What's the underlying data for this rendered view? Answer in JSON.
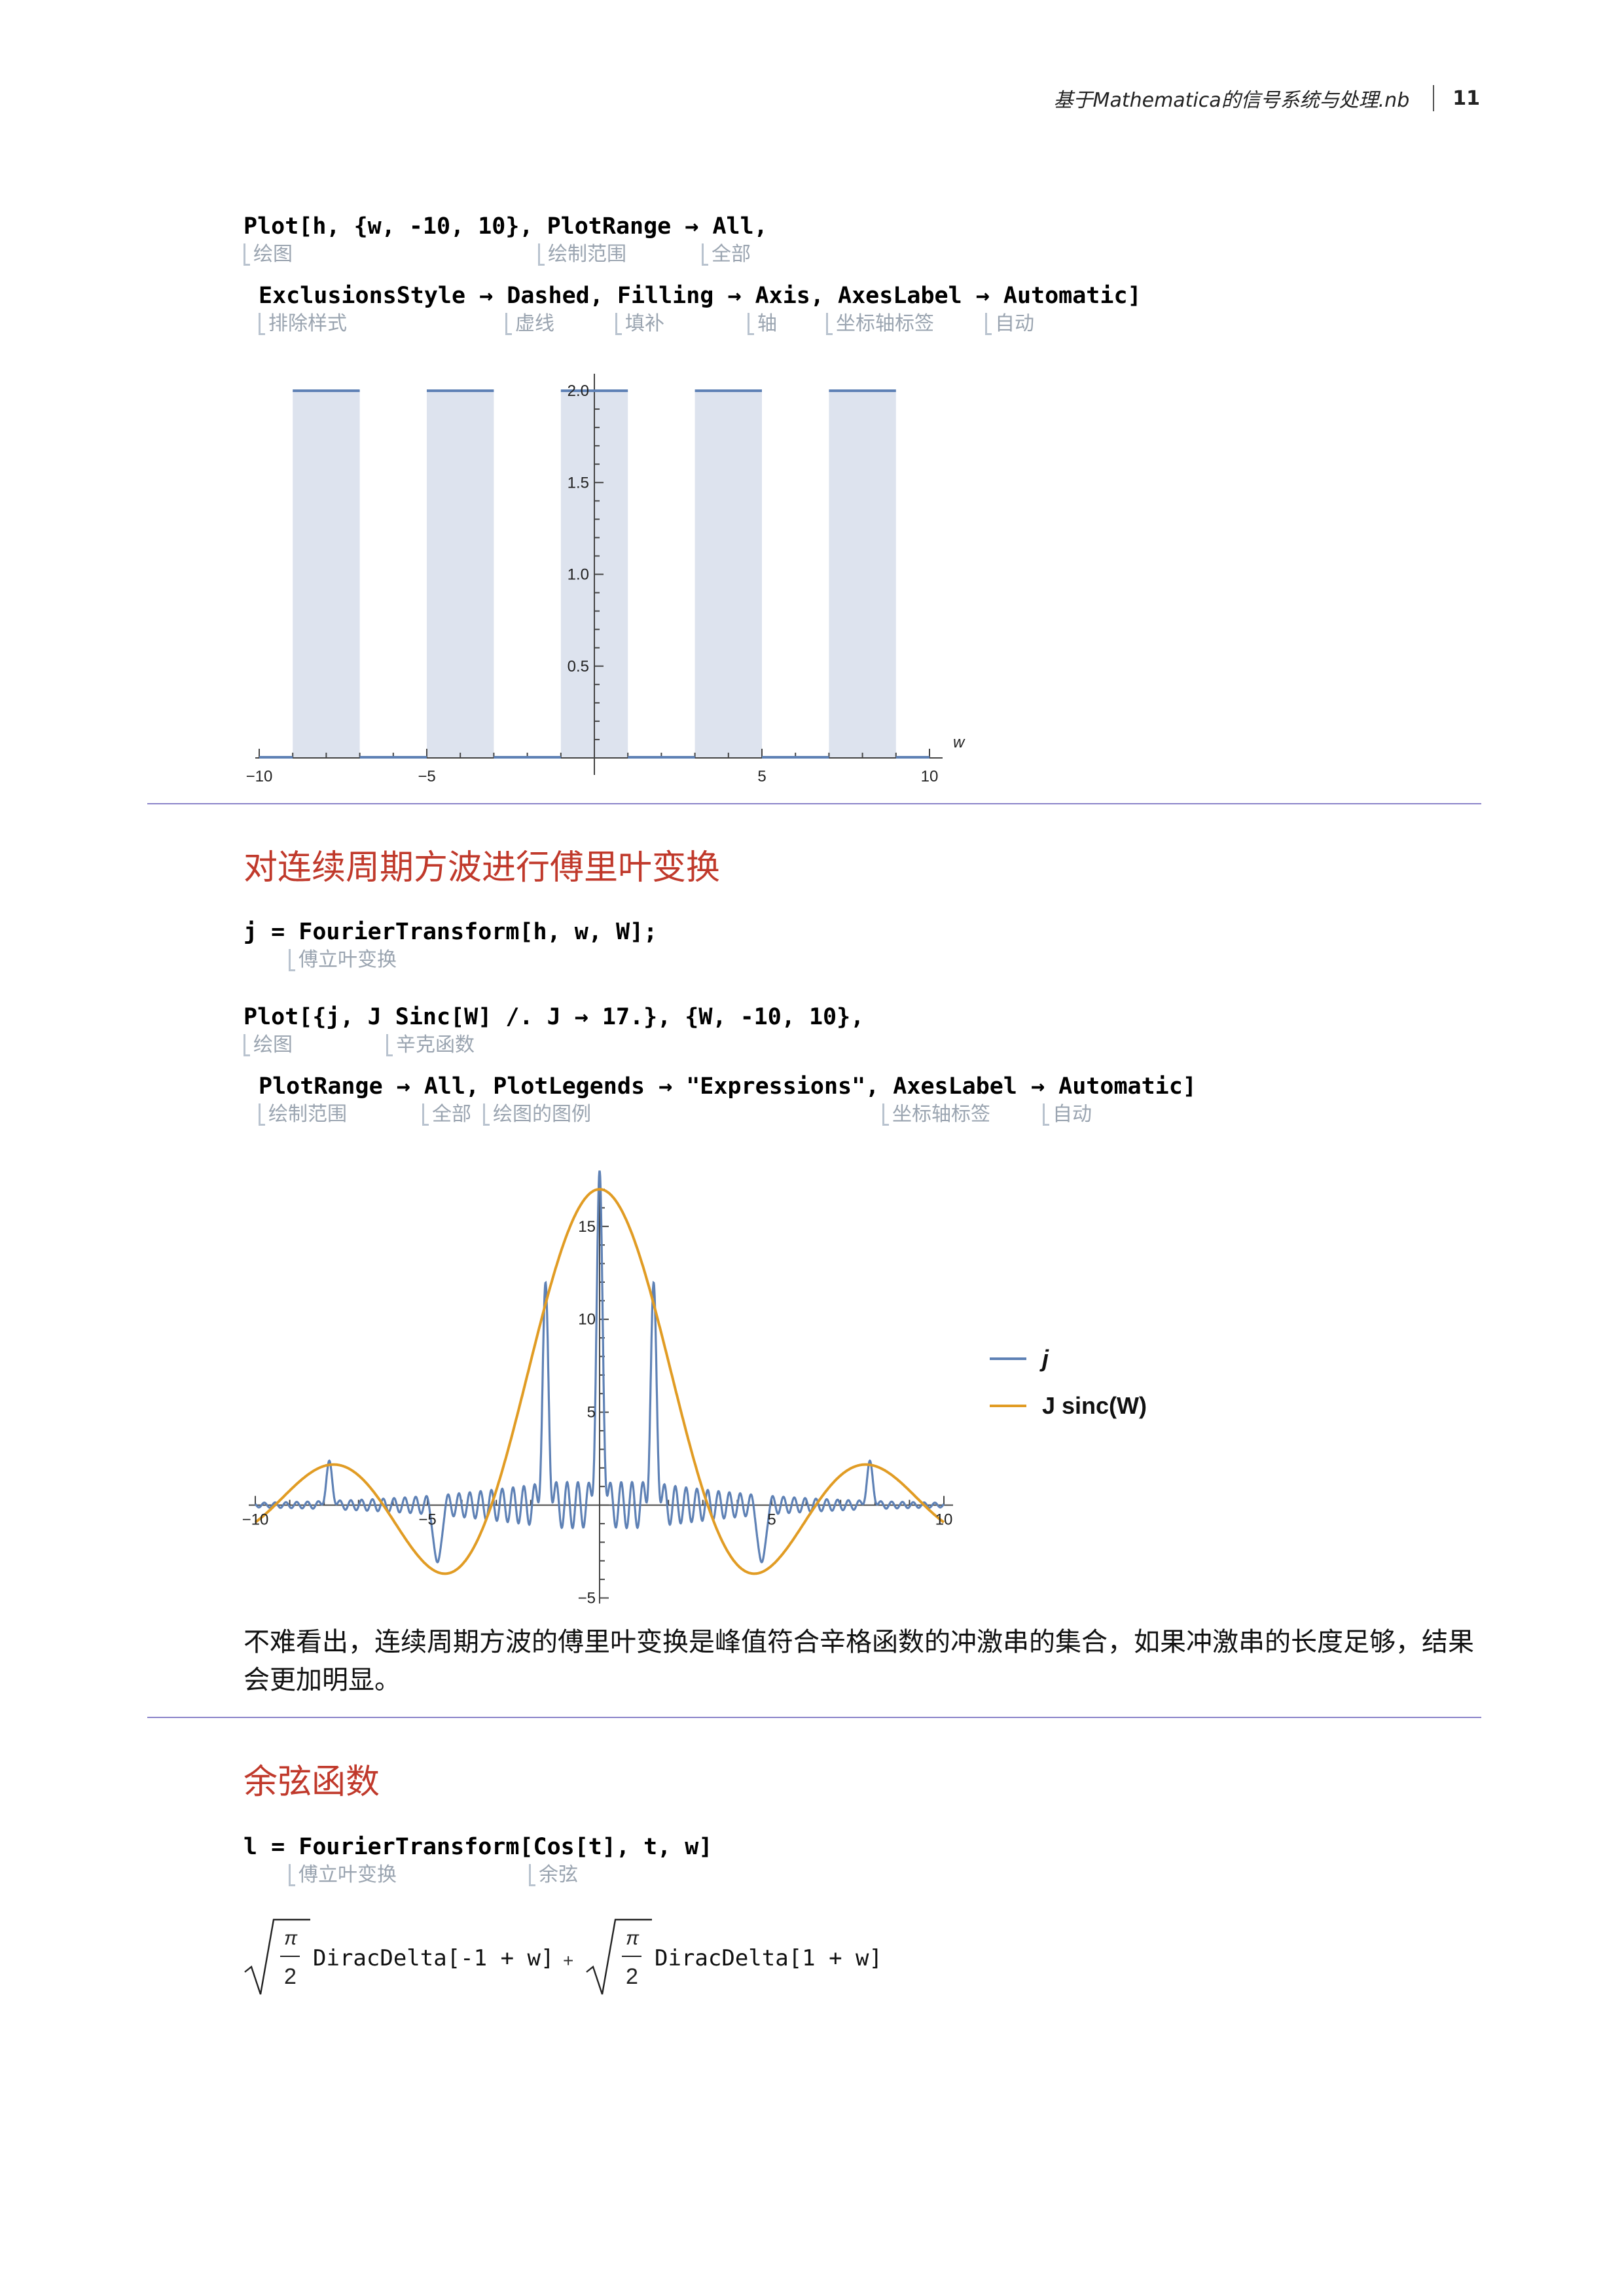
{
  "header": {
    "title": "基于Mathematica的信号系统与处理.nb",
    "page_number": "11"
  },
  "cell1": {
    "line1": "Plot[h, {w, -10, 10}, PlotRange → All,",
    "line2": "ExclusionsStyle → Dashed, Filling → Axis, AxesLabel → Automatic]",
    "hints1": [
      "绘图",
      "绘制范围",
      "全部"
    ],
    "hints2": [
      "排除样式",
      "虚线",
      "填补",
      "轴",
      "坐标轴标签",
      "自动"
    ]
  },
  "section1": {
    "title": "对连续周期方波进行傅里叶变换"
  },
  "cell2": {
    "line1": "j = FourierTransform[h, w, W];",
    "hints1": [
      "傅立叶变换"
    ]
  },
  "cell3": {
    "line1": "Plot[{j, J Sinc[W] /. J → 17.}, {W, -10, 10},",
    "line2": "PlotRange → All, PlotLegends → \"Expressions\", AxesLabel → Automatic]",
    "hints1": [
      "绘图",
      "辛克函数"
    ],
    "hints2": [
      "绘制范围",
      "全部",
      "绘图的图例",
      "坐标轴标签",
      "自动"
    ]
  },
  "paragraph1": "不难看出，连续周期方波的傅里叶变换是峰值符合辛格函数的冲激串的集合，如果冲激串的长度足够，结果会更加明显。",
  "section2": {
    "title": "余弦函数"
  },
  "cell4": {
    "line1": "l = FourierTransform[Cos[t], t, w]",
    "hints1": [
      "傅立叶变换",
      "余弦"
    ]
  },
  "output4": {
    "pi": "π",
    "two": "2",
    "term1": "DiracDelta[-1 + w]",
    "plus": "+",
    "term2": "DiracDelta[1 + w]"
  },
  "chart_data": [
    {
      "type": "area",
      "x_label": "w",
      "xlim": [
        -10,
        10
      ],
      "ylim": [
        0,
        2.0
      ],
      "x_ticks": [
        "-10",
        "-5",
        "5",
        "10"
      ],
      "y_ticks": [
        "0.5",
        "1.0",
        "1.5",
        "2.0"
      ],
      "pulses": [
        [
          -9,
          -7
        ],
        [
          -5,
          -3
        ],
        [
          -1,
          1
        ],
        [
          3,
          5
        ],
        [
          7,
          9
        ]
      ],
      "pulse_height": 2,
      "series_color": "#5e81b5",
      "fill_color": "#dde3ee"
    },
    {
      "type": "line",
      "xlim": [
        -10,
        10
      ],
      "ylim": [
        -5,
        17
      ],
      "x_ticks": [
        "-10",
        "-5",
        "5",
        "10"
      ],
      "y_ticks": [
        "-5",
        "5",
        "10",
        "15"
      ],
      "series": [
        {
          "name": "j",
          "color": "#5e81b5"
        },
        {
          "name": "J sinc(W)",
          "color": "#e19c24",
          "amplitude": 17
        }
      ],
      "legend": [
        "j",
        "J sinc(W)"
      ],
      "legend_position": "right"
    }
  ]
}
